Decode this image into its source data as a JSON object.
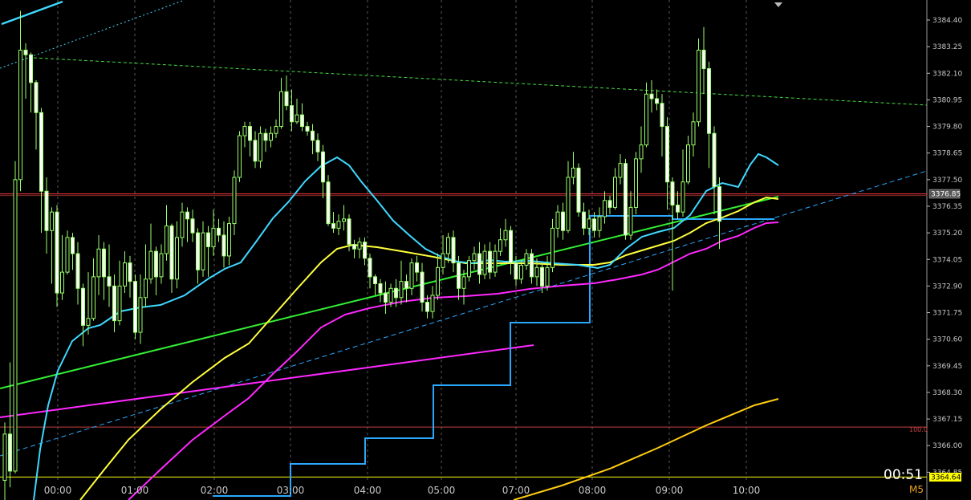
{
  "window": {
    "timeframe": "M5",
    "timer": "00:51",
    "current_price_label": "3376.85",
    "bottom_price_label": "3364.64",
    "level_label": "100.0"
  },
  "colors": {
    "background": "#000000",
    "candle_up": "#000000",
    "candle_down": "#ffffff",
    "candle_outline": "#9aff6a",
    "ma_cyan": "#3fd8ff",
    "ma_yellow": "#ffff3c",
    "ma_magenta": "#ff28ff",
    "trend_green": "#33ee33",
    "step_blue": "#2aa8ff",
    "current_price_line": "#ff3b3b",
    "bottom_level_line": "#ffff00",
    "level_100_line": "#c84040"
  },
  "chart_data": {
    "type": "candlestick",
    "timeframe": "M5",
    "y_ticks": [
      3384.4,
      3383.25,
      3382.1,
      3380.95,
      3379.8,
      3378.65,
      3377.5,
      3376.35,
      3375.2,
      3374.05,
      3372.9,
      3371.75,
      3370.6,
      3369.45,
      3368.3,
      3367.15,
      3366.0,
      3364.85
    ],
    "y_tick_labels": [
      "3384.40",
      "3383.25",
      "3382.10",
      "3380.95",
      "3379.80",
      "3378.65",
      "3377.50",
      "3376.35",
      "3375.20",
      "3374.05",
      "3372.90",
      "3371.75",
      "3370.60",
      "3369.45",
      "3368.30",
      "3367.15",
      "3366.00",
      "3364.85"
    ],
    "ylim": [
      3364.05,
      3385.0
    ],
    "x_labels": [
      "00:00",
      "01:00",
      "02:00",
      "03:00",
      "04:00",
      "05:00",
      "07:00",
      "08:00",
      "09:00",
      "10:00"
    ],
    "current_price": 3376.85,
    "bottom_price": 3364.64,
    "level_100": 3366.8,
    "candles": [
      [
        3364.5,
        3366.5,
        3363.5,
        3367.0
      ],
      [
        3366.5,
        3364.9,
        3364.2,
        3369.6
      ],
      [
        3364.9,
        3377.5,
        3364.8,
        3378.3
      ],
      [
        3377.5,
        3383.1,
        3377.0,
        3384.8
      ],
      [
        3383.1,
        3382.9,
        3381.0,
        3383.4
      ],
      [
        3382.9,
        3381.7,
        3380.4,
        3383.0
      ],
      [
        3381.7,
        3380.4,
        3378.8,
        3381.8
      ],
      [
        3380.4,
        3377.0,
        3375.2,
        3380.6
      ],
      [
        3377.0,
        3375.3,
        3374.3,
        3377.6
      ],
      [
        3375.3,
        3376.1,
        3373.0,
        3376.3
      ],
      [
        3376.1,
        3372.6,
        3372.0,
        3376.4
      ],
      [
        3372.6,
        3373.5,
        3372.3,
        3375.1
      ],
      [
        3373.5,
        3375.0,
        3373.4,
        3375.3
      ],
      [
        3375.0,
        3374.3,
        3373.6,
        3375.2
      ],
      [
        3374.3,
        3372.8,
        3372.1,
        3374.8
      ],
      [
        3372.8,
        3371.2,
        3370.3,
        3373.0
      ],
      [
        3371.2,
        3371.5,
        3370.8,
        3373.5
      ],
      [
        3371.5,
        3373.3,
        3371.4,
        3374.1
      ],
      [
        3373.3,
        3374.5,
        3372.5,
        3375.1
      ],
      [
        3374.5,
        3373.3,
        3372.3,
        3374.8
      ],
      [
        3373.3,
        3372.9,
        3372.0,
        3374.7
      ],
      [
        3372.9,
        3371.4,
        3370.9,
        3373.4
      ],
      [
        3371.4,
        3372.9,
        3371.2,
        3374.0
      ],
      [
        3372.9,
        3373.9,
        3372.6,
        3374.4
      ],
      [
        3373.9,
        3373.1,
        3372.4,
        3374.2
      ],
      [
        3373.1,
        3370.9,
        3370.6,
        3373.4
      ],
      [
        3370.9,
        3372.4,
        3370.4,
        3373.4
      ],
      [
        3372.4,
        3373.2,
        3372.0,
        3374.7
      ],
      [
        3373.2,
        3374.4,
        3373.0,
        3375.6
      ],
      [
        3374.4,
        3373.3,
        3372.5,
        3374.6
      ],
      [
        3373.3,
        3374.3,
        3373.0,
        3374.7
      ],
      [
        3374.3,
        3375.5,
        3374.0,
        3376.4
      ],
      [
        3375.5,
        3373.2,
        3372.6,
        3375.6
      ],
      [
        3373.2,
        3375.0,
        3372.8,
        3375.7
      ],
      [
        3375.0,
        3376.1,
        3374.6,
        3376.5
      ],
      [
        3376.1,
        3375.8,
        3374.8,
        3376.3
      ],
      [
        3375.8,
        3375.2,
        3374.8,
        3376.2
      ],
      [
        3375.2,
        3373.6,
        3373.0,
        3375.4
      ],
      [
        3373.6,
        3375.2,
        3373.3,
        3375.7
      ],
      [
        3375.2,
        3374.6,
        3373.3,
        3375.5
      ],
      [
        3374.6,
        3375.4,
        3374.2,
        3376.2
      ],
      [
        3375.4,
        3375.1,
        3374.8,
        3375.8
      ],
      [
        3375.1,
        3374.2,
        3373.7,
        3375.7
      ],
      [
        3374.2,
        3375.6,
        3373.8,
        3375.9
      ],
      [
        3375.6,
        3377.6,
        3375.1,
        3377.9
      ],
      [
        3377.6,
        3379.4,
        3377.4,
        3379.6
      ],
      [
        3379.4,
        3379.8,
        3378.9,
        3380.0
      ],
      [
        3379.8,
        3379.2,
        3378.5,
        3380.0
      ],
      [
        3379.2,
        3378.3,
        3378.0,
        3379.6
      ],
      [
        3378.3,
        3379.5,
        3378.0,
        3379.8
      ],
      [
        3379.5,
        3379.2,
        3378.7,
        3379.7
      ],
      [
        3379.2,
        3379.5,
        3378.9,
        3379.8
      ],
      [
        3379.5,
        3379.8,
        3379.3,
        3380.1
      ],
      [
        3379.8,
        3381.3,
        3379.7,
        3381.9
      ],
      [
        3381.3,
        3380.7,
        3380.5,
        3382.0
      ],
      [
        3380.7,
        3380.0,
        3379.6,
        3381.4
      ],
      [
        3380.0,
        3380.3,
        3379.9,
        3381.0
      ],
      [
        3380.3,
        3379.8,
        3379.6,
        3380.8
      ],
      [
        3379.8,
        3379.6,
        3379.4,
        3380.0
      ],
      [
        3379.6,
        3379.2,
        3378.6,
        3379.9
      ],
      [
        3379.2,
        3378.7,
        3378.3,
        3379.5
      ],
      [
        3378.7,
        3377.4,
        3376.7,
        3379.0
      ],
      [
        3377.4,
        3375.6,
        3375.5,
        3377.7
      ],
      [
        3375.6,
        3375.4,
        3375.2,
        3376.1
      ],
      [
        3375.4,
        3375.7,
        3375.1,
        3376.0
      ],
      [
        3375.7,
        3375.8,
        3375.3,
        3376.4
      ],
      [
        3375.8,
        3374.7,
        3374.4,
        3376.0
      ],
      [
        3374.7,
        3374.5,
        3374.1,
        3374.9
      ],
      [
        3374.5,
        3374.8,
        3374.1,
        3375.0
      ],
      [
        3374.8,
        3374.1,
        3373.8,
        3375.0
      ],
      [
        3374.1,
        3373.3,
        3372.8,
        3374.3
      ],
      [
        3373.3,
        3373.0,
        3372.5,
        3373.4
      ],
      [
        3373.0,
        3372.6,
        3372.2,
        3373.2
      ],
      [
        3372.6,
        3372.2,
        3371.7,
        3373.1
      ],
      [
        3372.2,
        3372.8,
        3372.0,
        3373.0
      ],
      [
        3372.8,
        3372.4,
        3372.0,
        3373.2
      ],
      [
        3372.4,
        3373.1,
        3372.1,
        3374.0
      ],
      [
        3373.1,
        3372.8,
        3372.2,
        3373.4
      ],
      [
        3372.8,
        3373.9,
        3372.5,
        3374.1
      ],
      [
        3373.9,
        3373.5,
        3373.1,
        3374.2
      ],
      [
        3373.5,
        3372.2,
        3371.8,
        3373.9
      ],
      [
        3372.2,
        3371.8,
        3371.5,
        3372.5
      ],
      [
        3371.8,
        3372.5,
        3371.5,
        3372.9
      ],
      [
        3372.5,
        3373.7,
        3372.3,
        3374.3
      ],
      [
        3373.7,
        3374.3,
        3373.4,
        3375.1
      ],
      [
        3374.3,
        3375.0,
        3373.9,
        3375.2
      ],
      [
        3375.0,
        3373.9,
        3373.5,
        3375.3
      ],
      [
        3373.9,
        3372.8,
        3372.3,
        3374.2
      ],
      [
        3372.8,
        3373.3,
        3372.1,
        3373.6
      ],
      [
        3373.3,
        3374.0,
        3373.1,
        3374.2
      ],
      [
        3374.0,
        3374.3,
        3373.6,
        3374.6
      ],
      [
        3374.3,
        3373.4,
        3373.0,
        3374.8
      ],
      [
        3373.4,
        3374.4,
        3373.2,
        3374.7
      ],
      [
        3374.4,
        3373.5,
        3373.2,
        3374.8
      ],
      [
        3373.5,
        3374.4,
        3373.3,
        3374.7
      ],
      [
        3374.4,
        3374.9,
        3374.2,
        3375.4
      ],
      [
        3374.9,
        3375.3,
        3374.6,
        3375.8
      ],
      [
        3375.3,
        3373.9,
        3373.4,
        3375.5
      ],
      [
        3373.9,
        3373.2,
        3372.9,
        3374.2
      ],
      [
        3373.2,
        3373.8,
        3373.0,
        3374.0
      ],
      [
        3373.8,
        3374.3,
        3373.6,
        3374.5
      ],
      [
        3374.3,
        3373.3,
        3373.0,
        3374.5
      ],
      [
        3373.3,
        3373.7,
        3372.9,
        3374.1
      ],
      [
        3373.7,
        3372.9,
        3372.6,
        3373.9
      ],
      [
        3372.9,
        3373.7,
        3372.7,
        3374.2
      ],
      [
        3373.7,
        3375.4,
        3373.5,
        3375.8
      ],
      [
        3375.4,
        3376.1,
        3375.0,
        3376.4
      ],
      [
        3376.1,
        3375.3,
        3374.9,
        3376.5
      ],
      [
        3375.3,
        3377.6,
        3375.2,
        3378.3
      ],
      [
        3377.6,
        3378.0,
        3377.3,
        3378.7
      ],
      [
        3378.0,
        3376.1,
        3375.9,
        3378.2
      ],
      [
        3376.1,
        3375.4,
        3375.1,
        3376.5
      ],
      [
        3375.4,
        3375.8,
        3375.1,
        3376.2
      ],
      [
        3375.8,
        3375.3,
        3375.0,
        3376.1
      ],
      [
        3375.3,
        3375.9,
        3375.0,
        3376.3
      ],
      [
        3375.9,
        3376.6,
        3375.6,
        3377.0
      ],
      [
        3376.6,
        3376.3,
        3376.0,
        3376.8
      ],
      [
        3376.3,
        3377.6,
        3376.2,
        3378.0
      ],
      [
        3377.6,
        3378.2,
        3377.3,
        3378.6
      ],
      [
        3378.2,
        3375.1,
        3374.9,
        3378.4
      ],
      [
        3375.1,
        3376.3,
        3374.9,
        3377.0
      ],
      [
        3376.3,
        3378.4,
        3376.0,
        3378.7
      ],
      [
        3378.4,
        3379.0,
        3377.8,
        3379.8
      ],
      [
        3379.0,
        3381.2,
        3378.9,
        3381.7
      ],
      [
        3381.2,
        3381.0,
        3380.4,
        3381.8
      ],
      [
        3381.0,
        3380.8,
        3380.5,
        3381.4
      ],
      [
        3380.8,
        3379.8,
        3378.5,
        3381.2
      ],
      [
        3379.8,
        3377.4,
        3376.2,
        3380.2
      ],
      [
        3377.4,
        3376.4,
        3372.7,
        3377.6
      ],
      [
        3376.4,
        3376.1,
        3375.8,
        3377.0
      ],
      [
        3376.1,
        3377.4,
        3375.9,
        3378.8
      ],
      [
        3377.4,
        3379.0,
        3377.3,
        3379.4
      ],
      [
        3379.0,
        3380.0,
        3378.5,
        3380.4
      ],
      [
        3380.0,
        3383.1,
        3379.8,
        3383.6
      ],
      [
        3383.1,
        3382.3,
        3381.2,
        3384.1
      ],
      [
        3382.3,
        3379.5,
        3378.0,
        3382.6
      ],
      [
        3379.5,
        3377.2,
        3376.0,
        3379.8
      ],
      [
        3377.2,
        3375.7,
        3374.5,
        3377.6
      ]
    ]
  }
}
